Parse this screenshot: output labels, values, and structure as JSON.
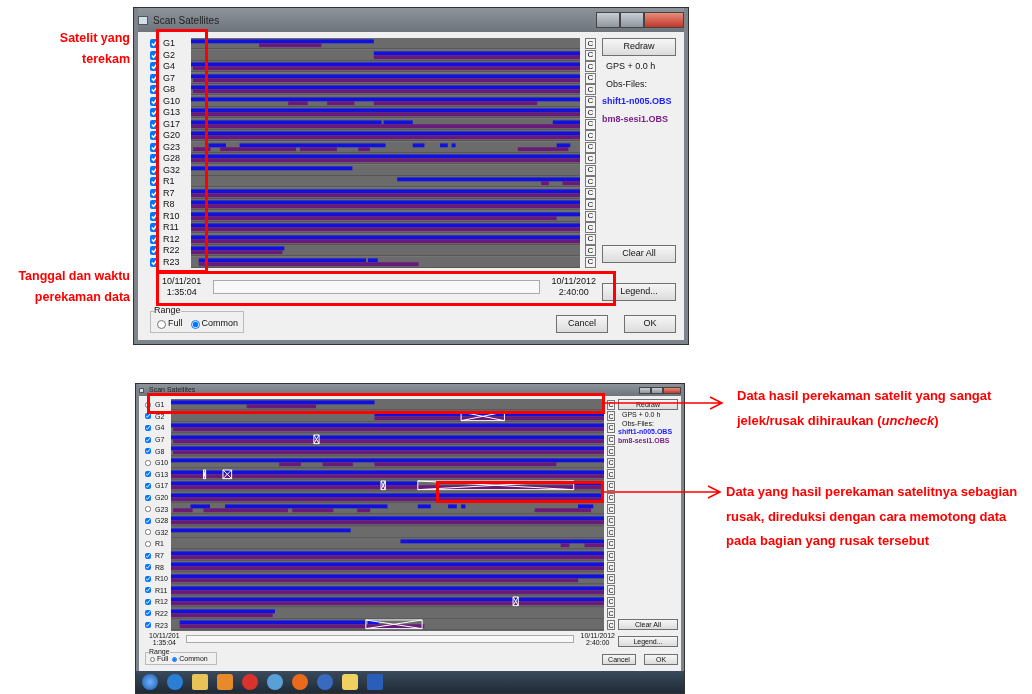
{
  "annotations_left": [
    {
      "text": "Satelit yang terekam"
    },
    {
      "text": "Tanggal dan waktu perekaman data"
    }
  ],
  "annotations_right": [
    {
      "text": "Data hasil perekaman satelit yang sangat jelek/rusak dihiraukan (*uncheck*)"
    },
    {
      "text": "Data yang hasil perekaman satelitnya sebagian rusak, direduksi dengan cara memotong data pada bagian yang rusak tersebut"
    }
  ],
  "windows": [
    {
      "title": "Scan Satellites",
      "has_taskbar": false,
      "satellites": [
        {
          "label": "G1",
          "checked": true,
          "cut": "C"
        },
        {
          "label": "G2",
          "checked": true,
          "cut": "C"
        },
        {
          "label": "G4",
          "checked": true,
          "cut": "C"
        },
        {
          "label": "G7",
          "checked": true,
          "cut": "C"
        },
        {
          "label": "G8",
          "checked": true,
          "cut": "C"
        },
        {
          "label": "G10",
          "checked": true,
          "cut": "C"
        },
        {
          "label": "G13",
          "checked": true,
          "cut": "C"
        },
        {
          "label": "G17",
          "checked": true,
          "cut": "C"
        },
        {
          "label": "G20",
          "checked": true,
          "cut": "C"
        },
        {
          "label": "G23",
          "checked": true,
          "cut": "C"
        },
        {
          "label": "G28",
          "checked": true,
          "cut": "C"
        },
        {
          "label": "G32",
          "checked": true,
          "cut": "C"
        },
        {
          "label": "R1",
          "checked": true,
          "cut": "C"
        },
        {
          "label": "R7",
          "checked": true,
          "cut": "C"
        },
        {
          "label": "R8",
          "checked": true,
          "cut": "C"
        },
        {
          "label": "R10",
          "checked": true,
          "cut": "C"
        },
        {
          "label": "R11",
          "checked": true,
          "cut": "C"
        },
        {
          "label": "R12",
          "checked": true,
          "cut": "C"
        },
        {
          "label": "R22",
          "checked": true,
          "cut": "C"
        },
        {
          "label": "R23",
          "checked": true,
          "cut": "C"
        }
      ],
      "redraw": "Redraw",
      "gps": "GPS + 0.0 h",
      "obs_label": "Obs-Files:",
      "obs_files": [
        {
          "name": "shift1-n005.OBS",
          "color": "#2020ff"
        },
        {
          "name": "bm8-sesi1.OBS",
          "color": "#7a1f8a"
        }
      ],
      "start_time": [
        "10/11/201",
        "1:35:04"
      ],
      "end_time": [
        "10/11/2012",
        "2:40:00"
      ],
      "clear_all": "Clear All",
      "legend": "Legend...",
      "cancel": "Cancel",
      "ok": "OK",
      "range": {
        "label": "Range",
        "options": [
          {
            "label": "Full",
            "selected": false
          },
          {
            "label": "Common",
            "selected": true
          }
        ]
      }
    },
    {
      "title": "Scan Satellites",
      "has_taskbar": true,
      "satellites": [
        {
          "label": "G1",
          "checked": false,
          "cut": "C"
        },
        {
          "label": "G2",
          "checked": true,
          "cut": "C"
        },
        {
          "label": "G4",
          "checked": true,
          "cut": "C"
        },
        {
          "label": "G7",
          "checked": true,
          "cut": "C"
        },
        {
          "label": "G8",
          "checked": true,
          "cut": "C"
        },
        {
          "label": "G10",
          "checked": false,
          "cut": "C"
        },
        {
          "label": "G13",
          "checked": true,
          "cut": "C"
        },
        {
          "label": "G17",
          "checked": true,
          "cut": "C"
        },
        {
          "label": "G20",
          "checked": true,
          "cut": "C"
        },
        {
          "label": "G23",
          "checked": false,
          "cut": "C"
        },
        {
          "label": "G28",
          "checked": true,
          "cut": "C"
        },
        {
          "label": "G32",
          "checked": false,
          "cut": "C"
        },
        {
          "label": "R1",
          "checked": false,
          "cut": "C"
        },
        {
          "label": "R7",
          "checked": true,
          "cut": "C"
        },
        {
          "label": "R8",
          "checked": true,
          "cut": "C"
        },
        {
          "label": "R10",
          "checked": true,
          "cut": "C"
        },
        {
          "label": "R11",
          "checked": true,
          "cut": "C"
        },
        {
          "label": "R12",
          "checked": true,
          "cut": "C"
        },
        {
          "label": "R22",
          "checked": true,
          "cut": "C"
        },
        {
          "label": "R23",
          "checked": true,
          "cut": "C"
        }
      ],
      "redraw": "Redraw",
      "gps": "GPS + 0.0 h",
      "obs_label": "Obs-Files:",
      "obs_files": [
        {
          "name": "shift1-n005.OBS",
          "color": "#2020ff"
        },
        {
          "name": "bm8-sesi1.OBS",
          "color": "#7a1f8a"
        }
      ],
      "start_time": [
        "10/11/201",
        "1:35:04"
      ],
      "end_time": [
        "10/11/2012",
        "2:40:00"
      ],
      "clear_all": "Clear All",
      "legend": "Legend...",
      "cancel": "Cancel",
      "ok": "OK",
      "range": {
        "label": "Range",
        "options": [
          {
            "label": "Full",
            "selected": false
          },
          {
            "label": "Common",
            "selected": true
          }
        ]
      }
    }
  ]
}
